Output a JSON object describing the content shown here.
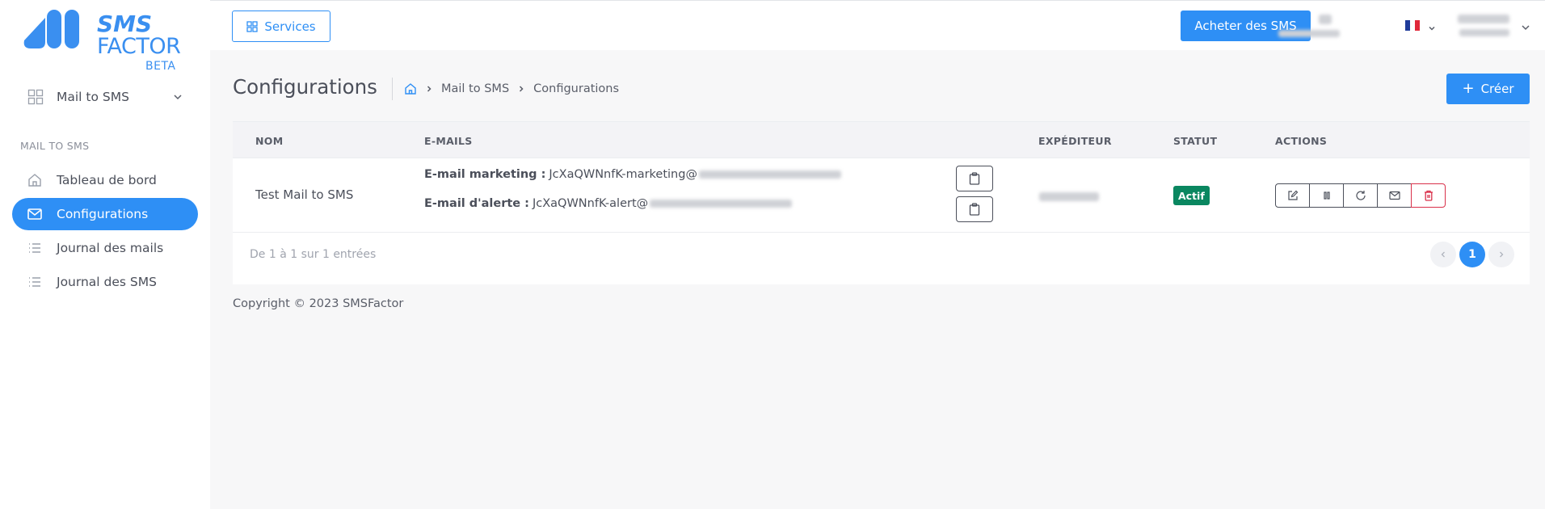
{
  "brand": {
    "logo_line1": "SMS",
    "logo_line2": "FACTOR",
    "logo_badge": "BETA",
    "color": "#3a8ff0"
  },
  "sidebar": {
    "product_selector": {
      "label": "Mail to SMS",
      "icon": "grid-icon"
    },
    "section_label": "MAIL TO SMS",
    "items": [
      {
        "label": "Tableau de bord",
        "icon": "home-icon",
        "active": false
      },
      {
        "label": "Configurations",
        "icon": "mail-icon",
        "active": true
      },
      {
        "label": "Journal des mails",
        "icon": "list-icon",
        "active": false
      },
      {
        "label": "Journal des SMS",
        "icon": "list-icon",
        "active": false
      }
    ]
  },
  "topbar": {
    "services_label": "Services",
    "buy_label": "Acheter des SMS",
    "language": "fr"
  },
  "page": {
    "title": "Configurations",
    "breadcrumb": [
      "Mail to SMS",
      "Configurations"
    ],
    "create_label": "Créer"
  },
  "table": {
    "columns": [
      "NOM",
      "E-MAILS",
      "EXPÉDITEUR",
      "STATUT",
      "ACTIONS"
    ],
    "rows": [
      {
        "name": "Test Mail to SMS",
        "email_marketing_label": "E-mail marketing :",
        "email_marketing_value": "JcXaQWNnfK-marketing@",
        "email_alert_label": "E-mail d'alerte :",
        "email_alert_value": "JcXaQWNnfK-alert@",
        "status": "Actif",
        "actions": [
          "edit-icon",
          "pause-icon",
          "refresh-icon",
          "mail-icon",
          "trash-icon"
        ]
      }
    ]
  },
  "footer": {
    "entries_text": "De 1 à 1 sur 1 entrées",
    "current_page": "1",
    "copyright": "Copyright © 2023 SMSFactor"
  },
  "colors": {
    "primary": "#2e8ff5",
    "success": "#0a8760",
    "danger": "#d9304a"
  }
}
